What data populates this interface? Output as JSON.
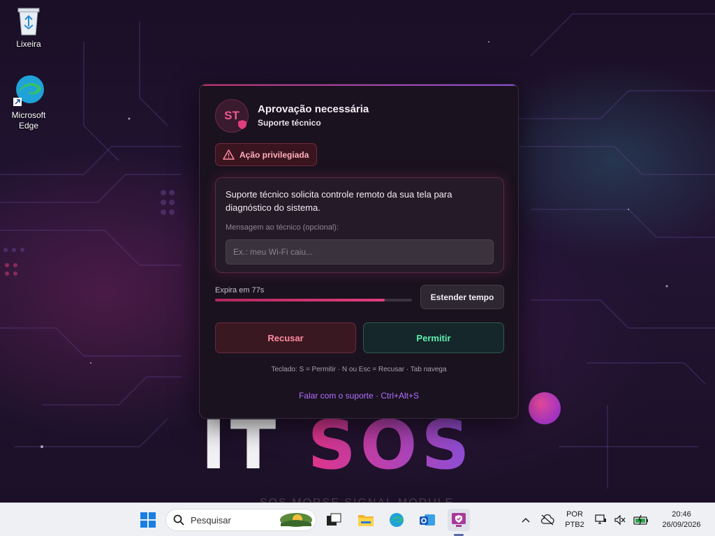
{
  "desktop": {
    "icons": [
      {
        "label": "Lixeira",
        "icon": "recycle-bin-icon"
      },
      {
        "label": "Microsoft Edge",
        "icon": "edge-icon"
      }
    ],
    "brand_text_a": "IT",
    "brand_text_b": "SOS",
    "brand_subtitle": "SOS MORSE SIGNAL MODULE"
  },
  "dialog": {
    "avatar_initials": "ST",
    "title": "Aprovação necessária",
    "subtitle": "Suporte técnico",
    "privileged_badge": "Ação privilegiada",
    "message": "Suporte técnico solicita controle remoto da sua tela para diagnóstico do sistema.",
    "message_label": "Mensagem ao técnico (opcional):",
    "message_input": {
      "value": "",
      "placeholder": "Ex.: meu Wi-Fi caiu..."
    },
    "expire_text": "Expira em 77s",
    "expire_progress": 0.86,
    "extend_button": "Estender tempo",
    "deny_button": "Recusar",
    "allow_button": "Permitir",
    "keyboard_hint": "Teclado: S = Permitir · N ou Esc = Recusar · Tab navega",
    "support_link": "Falar com o suporte · Ctrl+Alt+S",
    "colors": {
      "accent": "#e23d7e",
      "allow": "#5ef0b0",
      "deny": "#ff8aa0",
      "link": "#b070ff"
    }
  },
  "taskbar": {
    "search_placeholder": "Pesquisar",
    "apps": [
      "start-icon",
      "task-view-icon",
      "file-explorer-icon",
      "edge-icon",
      "outlook-icon",
      "approval-app-icon"
    ],
    "language_line1": "POR",
    "language_line2": "PTB2",
    "time": "20:46",
    "date": "26/09/2026"
  }
}
